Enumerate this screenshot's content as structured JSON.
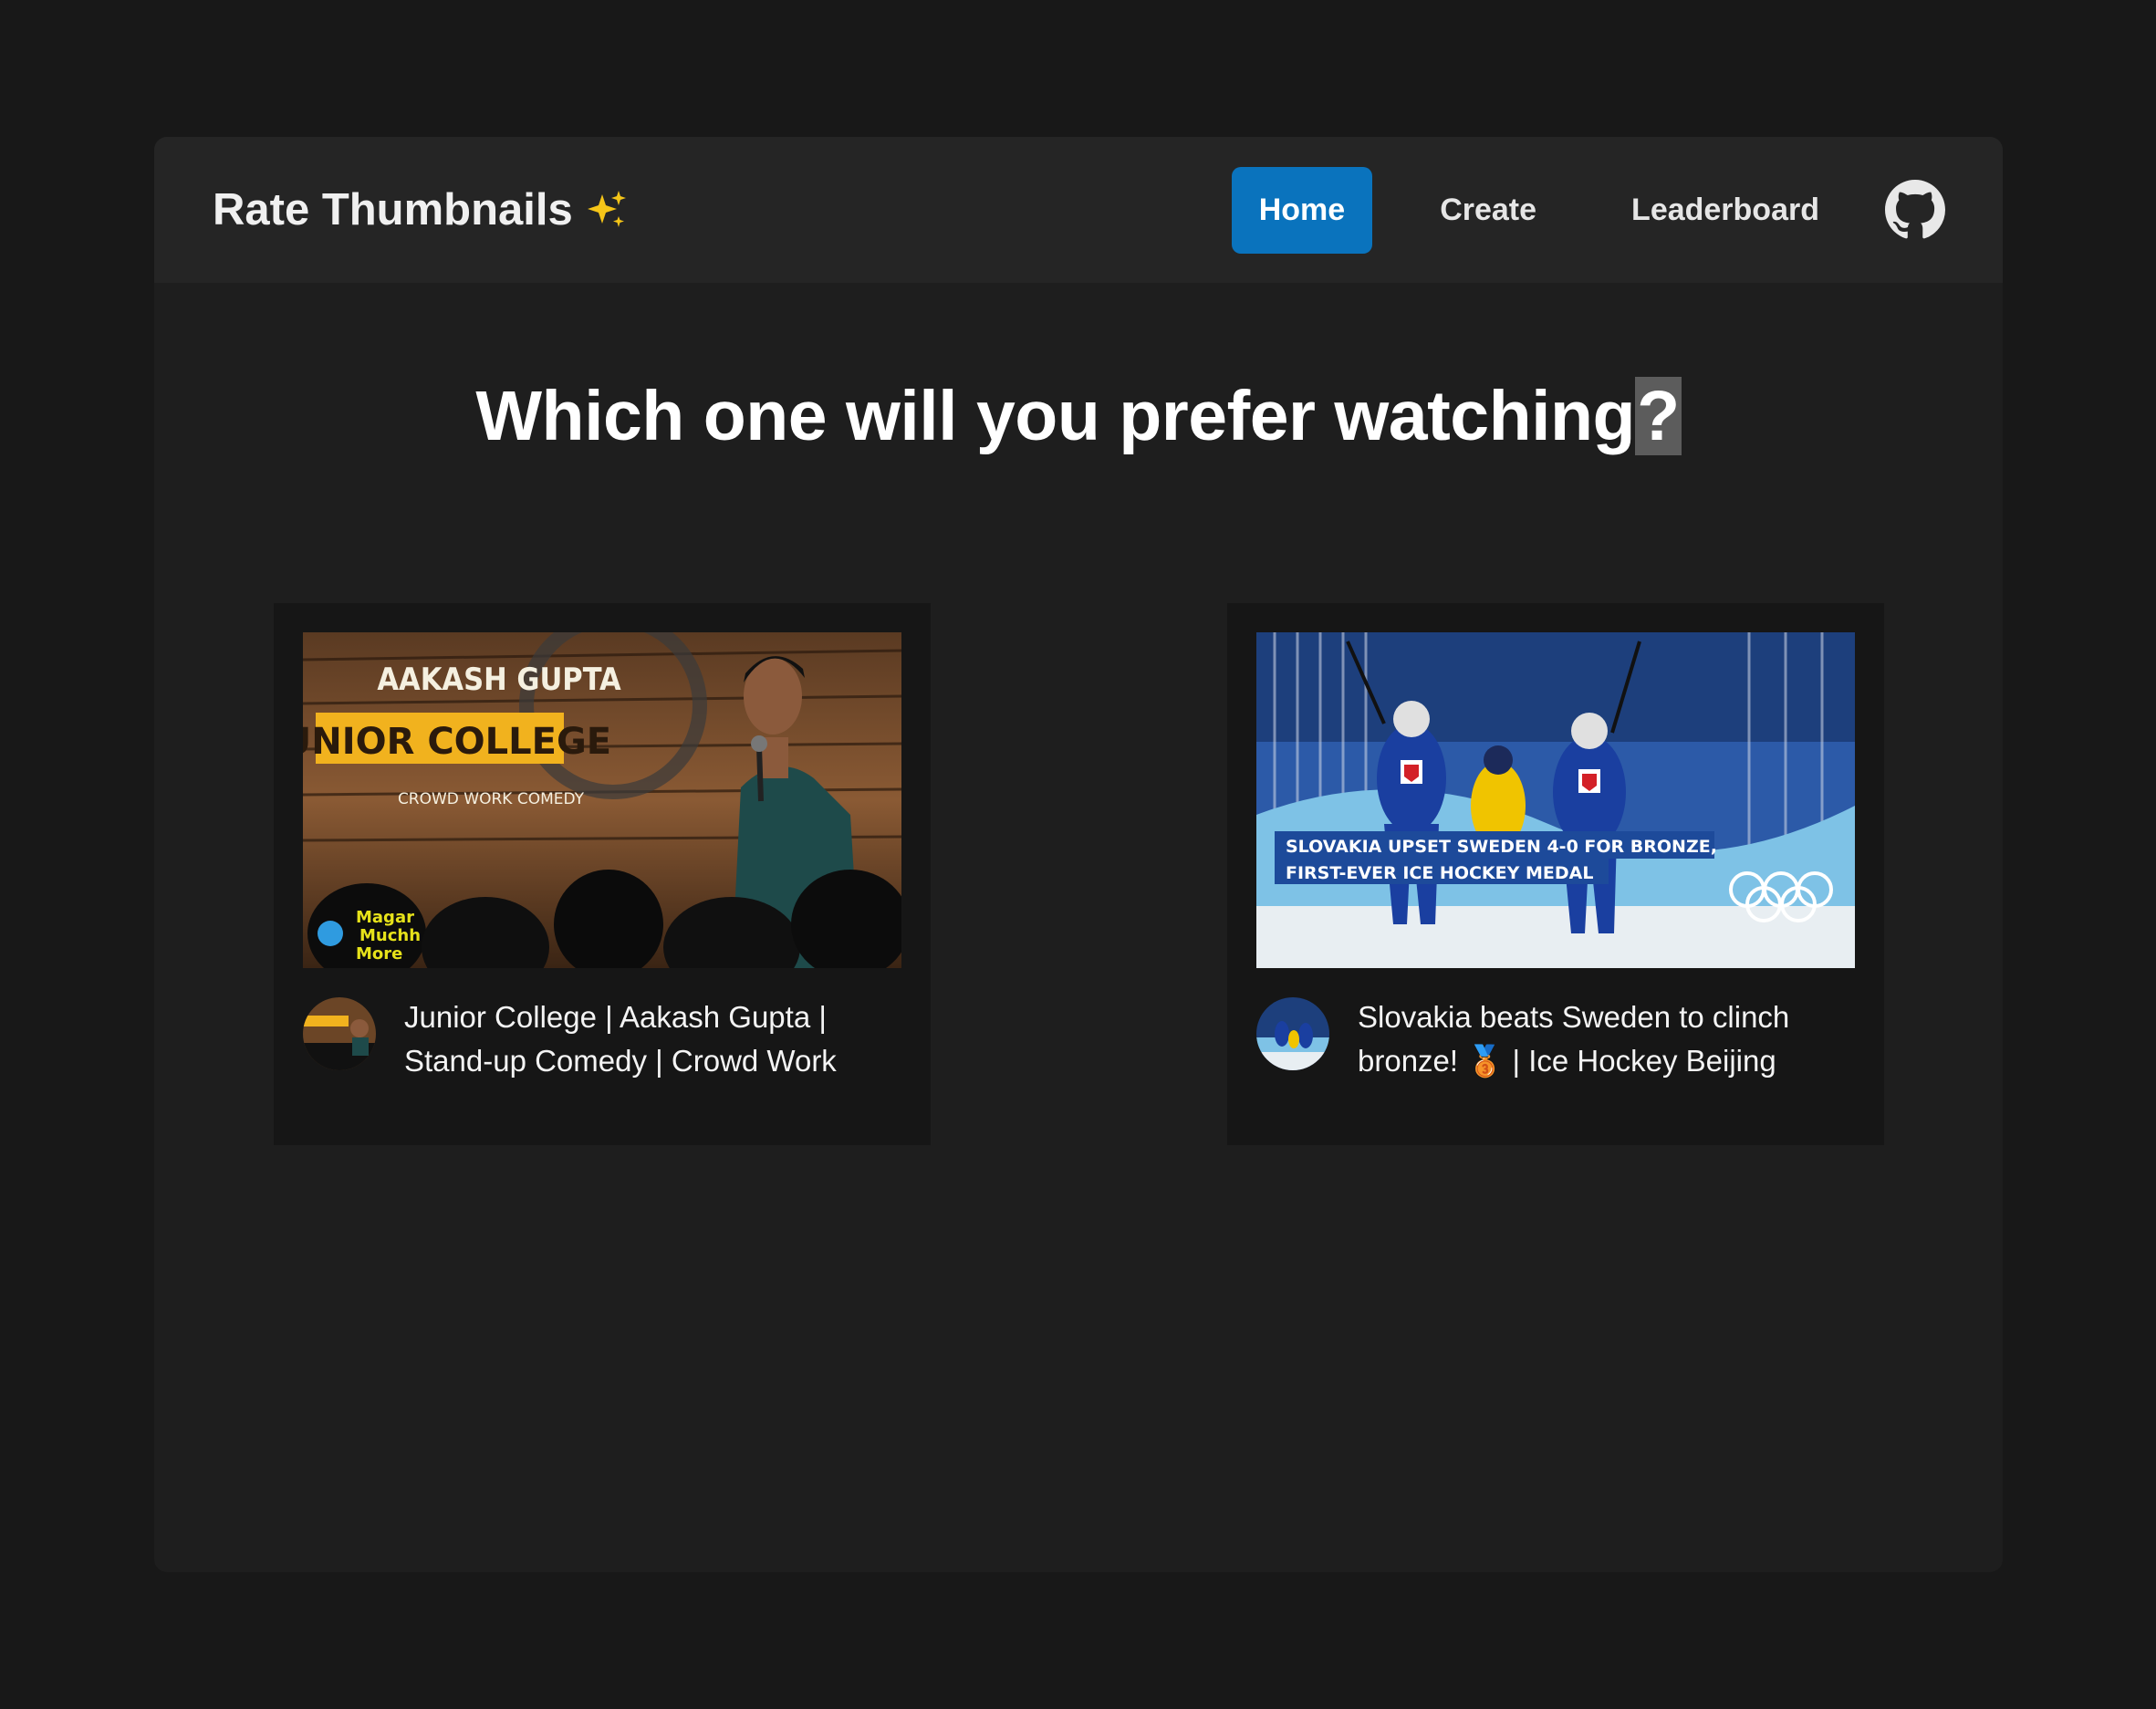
{
  "brand": {
    "title": "Rate Thumbnails",
    "emoji": "sparkles-icon"
  },
  "nav": {
    "home": "Home",
    "create": "Create",
    "leaderboard": "Leaderboard",
    "github_icon": "github-icon"
  },
  "question": {
    "text": "Which one will you prefer watching",
    "mark": "?"
  },
  "videos": [
    {
      "title_line1": "Junior College | Aakash Gupta |",
      "title_line2": "Stand-up Comedy | Crowd Work",
      "thumb_text": {
        "name": "AAKASH GUPTA",
        "show": "JUNIOR COLLEGE",
        "sub": "CROWD WORK COMEDY",
        "logo1": "Magar",
        "logo2": "Muchh",
        "logo3": "More"
      }
    },
    {
      "title_line1": "Slovakia beats Sweden to clinch",
      "title_line2": "bronze! 🥉 | Ice Hockey Beijing",
      "thumb_text": {
        "line1": "SLOVAKIA UPSET SWEDEN 4-0 FOR BRONZE,",
        "line2": "FIRST-EVER ICE HOCKEY MEDAL"
      }
    }
  ],
  "colors": {
    "accent": "#0a73bd",
    "background": "#181818",
    "panel": "#1e1e1e",
    "card": "#161616"
  }
}
